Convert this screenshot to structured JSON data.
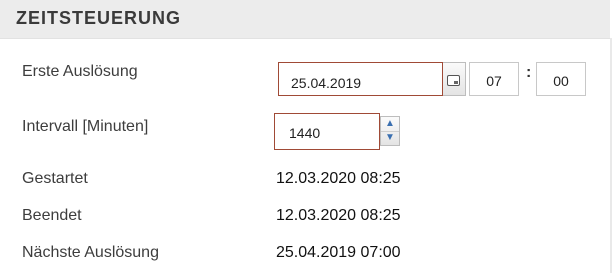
{
  "section": {
    "title": "ZEITSTEUERUNG"
  },
  "fields": {
    "first_trigger": {
      "label": "Erste Auslösung",
      "date": "25.04.2019",
      "hour": "07",
      "separator": ":",
      "minute": "00",
      "calendar_icon": "calendar-icon"
    },
    "interval": {
      "label": "Intervall [Minuten]",
      "value": "1440",
      "up_icon": "▲",
      "down_icon": "▼"
    },
    "started": {
      "label": "Gestartet",
      "value": "12.03.2020 08:25"
    },
    "ended": {
      "label": "Beendet",
      "value": "12.03.2020 08:25"
    },
    "next_trigger": {
      "label": "Nächste Auslösung",
      "value": "25.04.2019 07:00"
    }
  },
  "colors": {
    "header_bg": "#ececec",
    "focus_border": "#a04a36",
    "spinner_arrow": "#3a6fb0"
  }
}
